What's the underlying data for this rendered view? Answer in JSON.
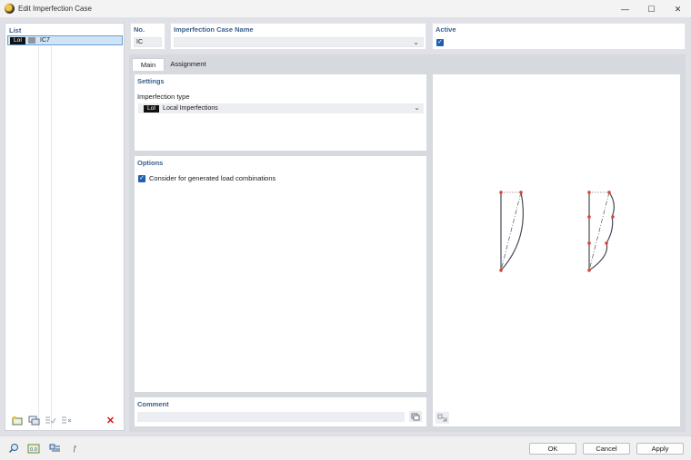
{
  "window": {
    "title": "Edit Imperfection Case",
    "minimize_icon": "minimize-icon",
    "maximize_icon": "maximize-icon",
    "close_icon": "close-icon"
  },
  "list": {
    "header": "List",
    "items": [
      {
        "tag": "LoI",
        "name": "IC7",
        "selected": true
      }
    ]
  },
  "fields": {
    "no_label": "No.",
    "no_value": "IC",
    "name_label": "Imperfection Case Name",
    "name_value": "",
    "active_label": "Active",
    "active_checked": true
  },
  "tabs": [
    {
      "label": "Main",
      "active": true
    },
    {
      "label": "Assignment",
      "active": false
    }
  ],
  "settings": {
    "header": "Settings",
    "imperfection_type_label": "Imperfection type",
    "imperfection_type_tag": "LoI",
    "imperfection_type_value": "Local Imperfections"
  },
  "options": {
    "header": "Options",
    "consider_label": "Consider for generated load combinations",
    "consider_checked": true
  },
  "comment": {
    "header": "Comment",
    "value": ""
  },
  "buttons": {
    "ok": "OK",
    "cancel": "Cancel",
    "apply": "Apply"
  },
  "colors": {
    "accent": "#3b5f8a",
    "checkbox": "#1f5fb3",
    "node": "#e0442b",
    "curve": "#4a4a5a",
    "selection": "#cfe4f7"
  }
}
